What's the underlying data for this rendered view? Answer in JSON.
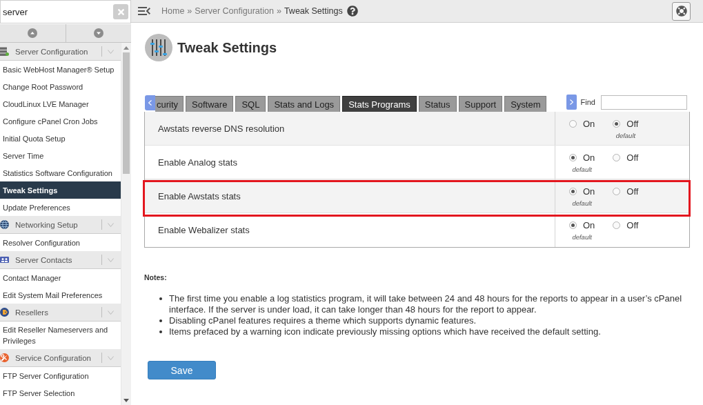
{
  "sidebar": {
    "search": {
      "value": "server"
    },
    "groups": [
      {
        "title": "Server Configuration",
        "items": [
          {
            "label": "Basic WebHost Manager® Setup",
            "selected": false
          },
          {
            "label": "Change Root Password",
            "selected": false
          },
          {
            "label": "CloudLinux LVE Manager",
            "selected": false
          },
          {
            "label": "Configure cPanel Cron Jobs",
            "selected": false
          },
          {
            "label": "Initial Quota Setup",
            "selected": false
          },
          {
            "label": "Server Time",
            "selected": false
          },
          {
            "label": "Statistics Software Configuration",
            "selected": false
          },
          {
            "label": "Tweak Settings",
            "selected": true
          },
          {
            "label": "Update Preferences",
            "selected": false
          }
        ]
      },
      {
        "title": "Networking Setup",
        "items": [
          {
            "label": "Resolver Configuration",
            "selected": false
          }
        ]
      },
      {
        "title": "Server Contacts",
        "items": [
          {
            "label": "Contact Manager",
            "selected": false
          },
          {
            "label": "Edit System Mail Preferences",
            "selected": false
          }
        ]
      },
      {
        "title": "Resellers",
        "items": [
          {
            "label": "Edit Reseller Nameservers and Privileges",
            "selected": false
          }
        ]
      },
      {
        "title": "Service Configuration",
        "items": [
          {
            "label": "FTP Server Configuration",
            "selected": false
          },
          {
            "label": "FTP Server Selection",
            "selected": false
          }
        ]
      }
    ]
  },
  "header": {
    "breadcrumb": [
      {
        "label": "Home",
        "separator": "»",
        "current": false
      },
      {
        "label": "Server Configuration",
        "separator": "»",
        "current": false
      },
      {
        "label": "Tweak Settings",
        "current": true
      }
    ]
  },
  "page": {
    "title": "Tweak Settings"
  },
  "tabs": [
    {
      "label": "curity",
      "selected": false
    },
    {
      "label": "Software",
      "selected": false
    },
    {
      "label": "SQL",
      "selected": false
    },
    {
      "label": "Stats and Logs",
      "selected": false
    },
    {
      "label": "Stats Programs",
      "selected": true
    },
    {
      "label": "Status",
      "selected": false
    },
    {
      "label": "Support",
      "selected": false
    },
    {
      "label": "System",
      "selected": false
    }
  ],
  "find": {
    "label": "Find"
  },
  "table": {
    "rows": [
      {
        "label": "Awstats reverse DNS resolution",
        "highlighted": false,
        "options": [
          {
            "label": "On",
            "selected": false
          },
          {
            "label": "Off",
            "selected": true,
            "note": "default"
          }
        ]
      },
      {
        "label": "Enable Analog stats",
        "highlighted": false,
        "options": [
          {
            "label": "On",
            "selected": true,
            "note": "default"
          },
          {
            "label": "Off",
            "selected": false
          }
        ]
      },
      {
        "label": "Enable Awstats stats",
        "highlighted": true,
        "options": [
          {
            "label": "On",
            "selected": true,
            "note": "default"
          },
          {
            "label": "Off",
            "selected": false
          }
        ]
      },
      {
        "label": "Enable Webalizer stats",
        "highlighted": false,
        "options": [
          {
            "label": "On",
            "selected": true,
            "note": "default"
          },
          {
            "label": "Off",
            "selected": false
          }
        ]
      }
    ]
  },
  "notes": {
    "title": "Notes:",
    "items": [
      "The first time you enable a log statistics program, it will take between 24 and 48 hours for the reports to appear in a user’s cPanel interface. If the server is under load, it can take longer than 48 hours for the report to appear.",
      "Disabling cPanel features requires a theme which supports dynamic features.",
      "Items prefaced by a warning icon indicate previously missing options which have received the default setting."
    ]
  },
  "save_button": {
    "label": "Save"
  }
}
